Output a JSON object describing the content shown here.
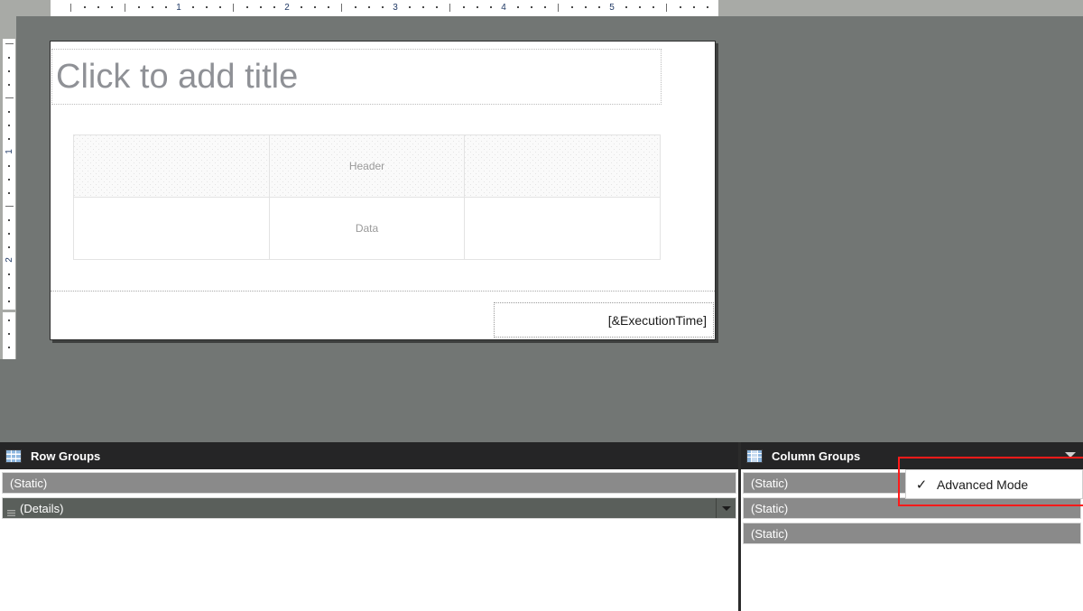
{
  "colors": {
    "canvas_background": "#727674",
    "panel_header_background": "#252526",
    "group_row_background": "#8a8a8a",
    "group_row_selected": "#5a5f5b",
    "highlight_red": "#ff1a1a",
    "title_placeholder_text": "#8f9196",
    "ruler_number": "#1f3864"
  },
  "ruler": {
    "horizontal_numbers": [
      "1",
      "2",
      "3",
      "4",
      "5"
    ],
    "vertical_numbers": [
      "1",
      "2"
    ]
  },
  "report": {
    "title_placeholder": "Click to add title",
    "matrix": {
      "header_row": [
        "",
        "Header",
        ""
      ],
      "data_row": [
        "",
        "Data",
        ""
      ]
    },
    "footer_expression": "[&ExecutionTime]"
  },
  "row_groups_panel": {
    "icon": "table-grid-icon",
    "title": "Row Groups",
    "rows": [
      {
        "label": "(Static)",
        "selected": false,
        "has_dropdown": false,
        "has_handle": false
      },
      {
        "label": "(Details)",
        "selected": true,
        "has_dropdown": true,
        "has_handle": true
      }
    ]
  },
  "column_groups_panel": {
    "icon": "column-grid-icon",
    "title": "Column Groups",
    "dropdown_icon": "chevron-down-icon",
    "rows": [
      {
        "label": "(Static)",
        "selected": false,
        "has_dropdown": false,
        "has_handle": false
      },
      {
        "label": "(Static)",
        "selected": false,
        "has_dropdown": false,
        "has_handle": false
      },
      {
        "label": "(Static)",
        "selected": false,
        "has_dropdown": false,
        "has_handle": false
      }
    ]
  },
  "context_menu": {
    "items": [
      {
        "label": "Advanced Mode",
        "checked": true,
        "check_glyph": "✓"
      }
    ]
  }
}
